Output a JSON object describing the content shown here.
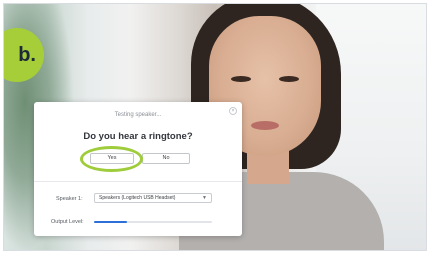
{
  "badge": {
    "label": "b."
  },
  "dialog": {
    "title": "Testing speaker...",
    "question": "Do you hear a ringtone?",
    "yes_label": "Yes",
    "no_label": "No",
    "speaker_label": "Speaker 1:",
    "speaker_value": "Speakers (Logitech USB Headset)",
    "output_label": "Output Level:",
    "output_level": 0.28
  },
  "colors": {
    "highlight": "#9fcc3b",
    "badge": "#a6ce39",
    "level_fill": "#2d6fd8"
  },
  "icons": {
    "close": "close-icon",
    "dropdown": "chevron-down-icon"
  }
}
